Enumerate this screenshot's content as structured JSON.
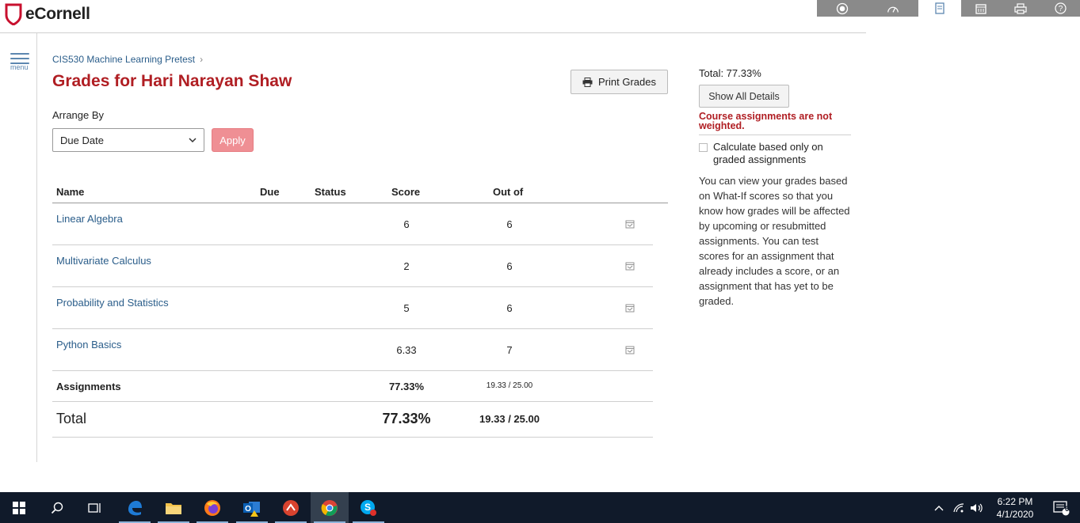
{
  "app": {
    "brand": "eCornell"
  },
  "toolbar_icons": [
    "record-icon",
    "dashboard-icon",
    "book-icon",
    "calendar-icon",
    "print-icon",
    "help-icon"
  ],
  "nav": {
    "menu_label": "menu"
  },
  "breadcrumb": {
    "course": "CIS530 Machine Learning Pretest",
    "separator": "›"
  },
  "page": {
    "title": "Grades for Hari Narayan Shaw",
    "print_label": "Print Grades"
  },
  "arrange": {
    "label": "Arrange By",
    "selected": "Due Date",
    "apply_label": "Apply"
  },
  "table": {
    "headers": {
      "name": "Name",
      "due": "Due",
      "status": "Status",
      "score": "Score",
      "out_of": "Out of"
    },
    "rows": [
      {
        "name": "Linear Algebra",
        "due": "",
        "status": "",
        "score": "6",
        "out_of": "6"
      },
      {
        "name": "Multivariate Calculus",
        "due": "",
        "status": "",
        "score": "2",
        "out_of": "6"
      },
      {
        "name": "Probability and Statistics",
        "due": "",
        "status": "",
        "score": "5",
        "out_of": "6"
      },
      {
        "name": "Python Basics",
        "due": "",
        "status": "",
        "score": "6.33",
        "out_of": "7"
      }
    ],
    "assignments": {
      "label": "Assignments",
      "percent": "77.33%",
      "fraction": "19.33 / 25.00"
    },
    "total": {
      "label": "Total",
      "percent": "77.33%",
      "fraction": "19.33 / 25.00"
    }
  },
  "sidebar": {
    "total": "Total: 77.33%",
    "show_details_label": "Show All Details",
    "warning": "Course assignments are not weighted.",
    "checkbox_label": "Calculate based only on graded assignments",
    "checkbox_checked": false,
    "help_text": "You can view your grades based on What-If scores so that you know how grades will be affected by upcoming or resubmitted assignments. You can test scores for an assignment that already includes a score, or an assignment that has yet to be graded."
  },
  "taskbar": {
    "time": "6:22 PM",
    "date": "4/1/2020",
    "notification_count": "6"
  },
  "colors": {
    "brand_red": "#b01e23",
    "link_blue": "#2a5d8a",
    "apply_pink": "#ef8f94",
    "taskbar": "#101a2a"
  }
}
